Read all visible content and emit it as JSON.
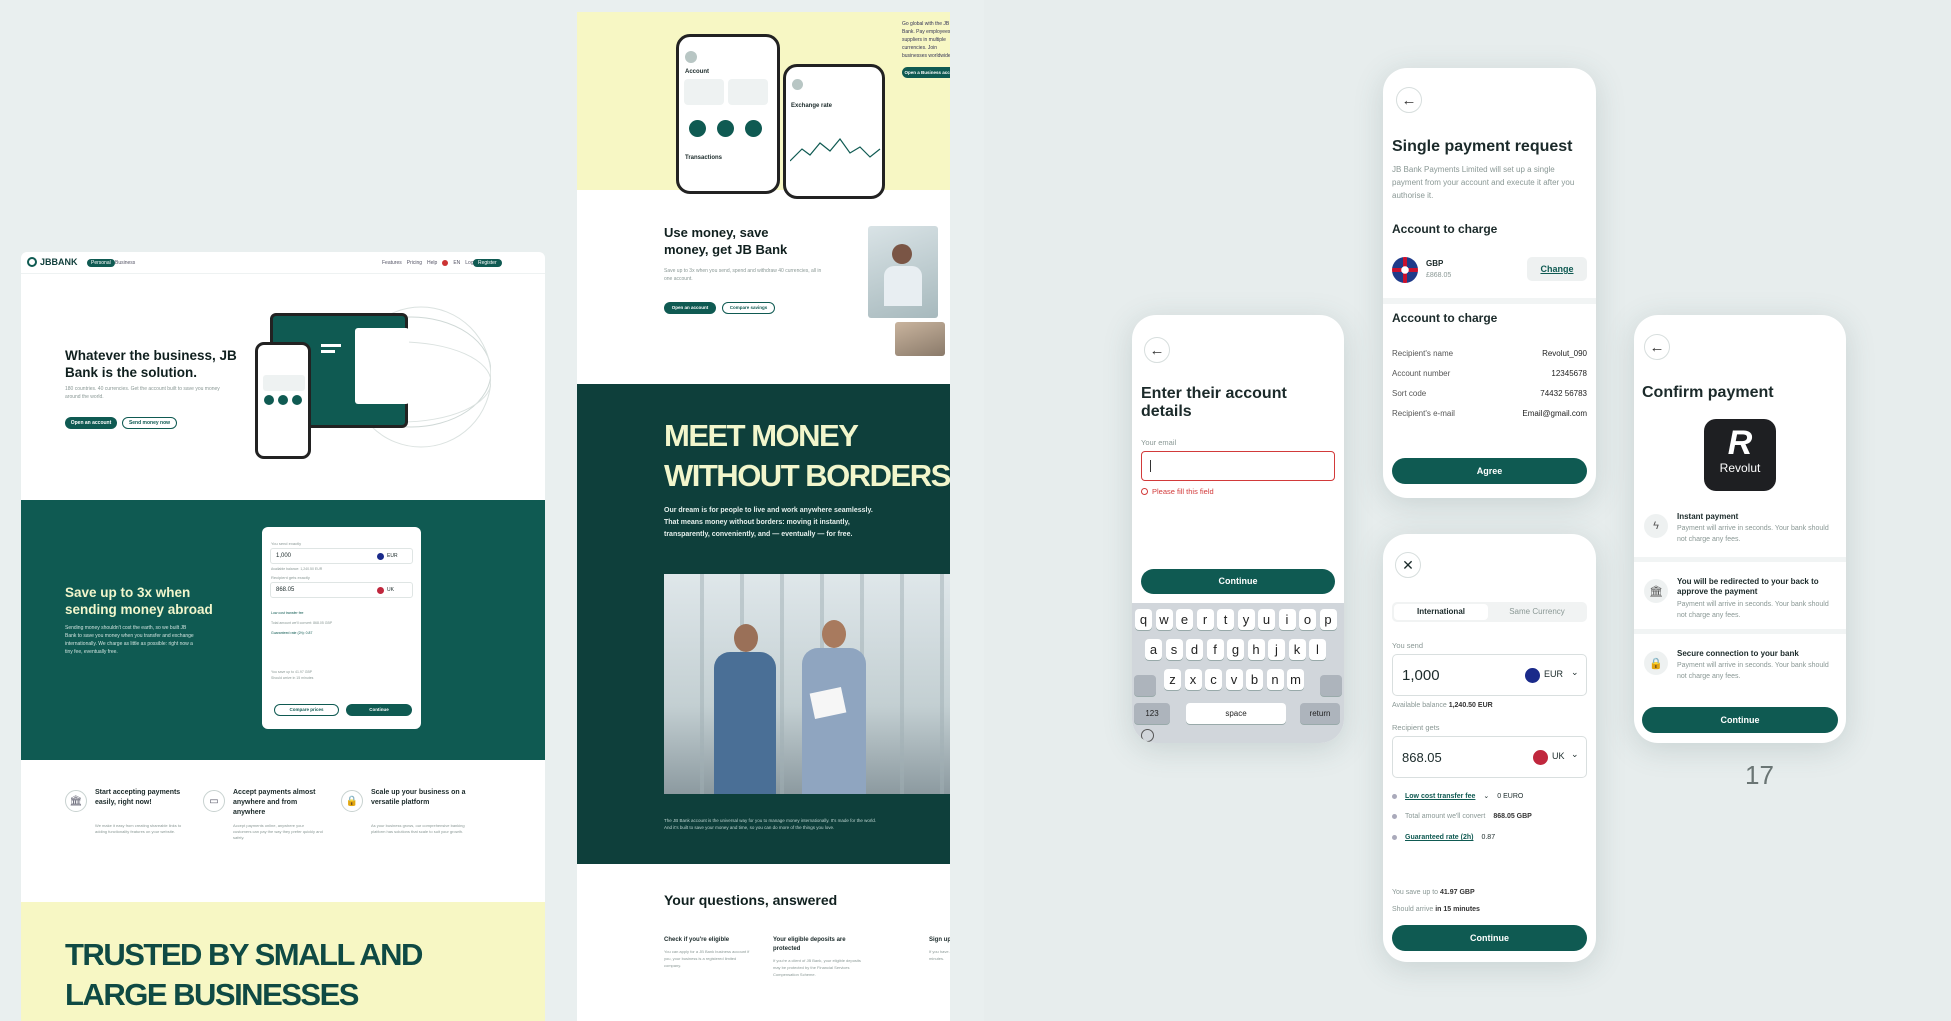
{
  "panel1": {
    "nav": {
      "logo": "JBBANK",
      "tabs": [
        "Personal",
        "Business"
      ],
      "links": [
        "Features",
        "Pricing",
        "Help",
        "EN",
        "Log in"
      ],
      "cta": "Register"
    },
    "hero": {
      "title": "Whatever the business, JB Bank is the solution.",
      "subtitle": "180 countries. 40 currencies. Get the account built to save you money around the world.",
      "btn1": "Open an account",
      "btn2": "Send money now"
    },
    "save": {
      "title": "Save up to 3x when sending money abroad",
      "body": "Sending money shouldn't cost the earth, so we built JB Bank to save you money when you transfer and exchange internationally. We charge as little as possible: right now a tiny fee, eventually free."
    },
    "converter": {
      "you_send_label": "You send exactly",
      "send_value": "1,000",
      "send_currency": "EUR",
      "balance": "Available balance: 1,240.50 EUR",
      "gets_label": "Recipient gets exactly",
      "gets_value": "868.05",
      "gets_currency": "UK",
      "fee": "Low cost transfer fee",
      "total": "Total amount we'll convert: 868.05 GBP",
      "rate": "Guaranteed rate (2h): 0.87",
      "save_note": "You save up to 41.97 GBP",
      "arrive": "Should arrive in 15 minutes",
      "btn_compare": "Compare prices",
      "btn_continue": "Continue"
    },
    "features": [
      {
        "icon": "bank-icon",
        "title": "Start accepting payments easily, right now!",
        "body": "We make it easy from creating shareable links to adding functionality features on your website."
      },
      {
        "icon": "card-icon",
        "title": "Accept payments almost anywhere and from anywhere",
        "body": "Accept payments online, anywhere your customers can pay the way they prefer quickly and safely."
      },
      {
        "icon": "lock-icon",
        "title": "Scale up your business on a versatile platform",
        "body": "As your business grows, our comprehensive banking platform has solutions that scale to suit your growth."
      }
    ],
    "trusted": "TRUSTED BY SMALL AND LARGE BUSINESSES"
  },
  "panel2": {
    "top_text": "Go global with the JB Bank. Pay employees, suppliers in multiple currencies. Join businesses worldwide.",
    "top_btn": "Open a Business account",
    "phone_account": "Account",
    "phone_transactions": "Transactions",
    "phone_rate": "Exchange rate",
    "use_money": {
      "title": "Use money, save money, get JB Bank",
      "body": "Save up to 3x when you send, spend and withdraw 40 currencies, all in one account.",
      "btn1": "Open an account",
      "btn2": "Compare savings"
    },
    "meet": {
      "title": "MEET MONEY WITHOUT BORDERS",
      "body": "Our dream is for people to live and work anywhere seamlessly. That means money without borders: moving it instantly, transparently, conveniently, and — eventually — for free.",
      "footer": "The JB Bank account is the universal way for you to manage money internationally. It's made for the world. And it's built to save your money and time, so you can do more of the things you love."
    },
    "faq": {
      "title": "Your questions, answered",
      "cols": [
        {
          "title": "Check if you're eligible",
          "body": "You can apply for a JB Bank business account if you, your business is a registered limited company."
        },
        {
          "title": "Your eligible deposits are protected",
          "body": "If you're a client of JB Bank, your eligible deposits may be protected by the Financial Services Compensation Scheme."
        },
        {
          "title": "Sign up",
          "body": "If you have a business, sign up in minutes."
        }
      ]
    }
  },
  "screen_email": {
    "title": "Enter their account details",
    "field_label": "Your email",
    "error": "Please fill this field",
    "btn": "Continue",
    "keys_row1": [
      "q",
      "w",
      "e",
      "r",
      "t",
      "y",
      "u",
      "i",
      "o",
      "p"
    ],
    "keys_row2": [
      "a",
      "s",
      "d",
      "f",
      "g",
      "h",
      "j",
      "k",
      "l"
    ],
    "keys_row3": [
      "z",
      "x",
      "c",
      "v",
      "b",
      "n",
      "m"
    ],
    "key_123": "123",
    "key_space": "space",
    "key_return": "return"
  },
  "screen_request": {
    "title": "Single payment request",
    "desc": "JB Bank Payments Limited will set up a single payment from your account and execute it after you authorise it.",
    "section1": "Account to charge",
    "currency": "GBP",
    "amount": "£868.05",
    "change": "Change",
    "section2": "Account to charge",
    "rows": [
      {
        "label": "Recipient's name",
        "value": "Revolut_090"
      },
      {
        "label": "Account number",
        "value": "12345678"
      },
      {
        "label": "Sort code",
        "value": "74432 56783"
      },
      {
        "label": "Recipient's e-mail",
        "value": "Email@gmail.com"
      }
    ],
    "btn": "Agree"
  },
  "screen_transfer": {
    "tab1": "International",
    "tab2": "Same Currency",
    "send_label": "You send",
    "send_value": "1,000",
    "send_currency": "EUR",
    "balance_prefix": "Available balance",
    "balance_value": "1,240.50 EUR",
    "gets_label": "Recipient gets",
    "gets_value": "868.05",
    "gets_currency": "UK",
    "fee_label": "Low cost transfer fee",
    "fee_value": "0 EURO",
    "total_label": "Total amount we'll convert",
    "total_value": "868.05 GBP",
    "rate_label": "Guaranteed rate (2h)",
    "rate_value": "0.87",
    "save_prefix": "You save up to",
    "save_value": "41.97 GBP",
    "arrive_prefix": "Should arrive",
    "arrive_value": "in 15 minutes",
    "btn": "Continue"
  },
  "screen_confirm": {
    "title": "Confirm payment",
    "logo_text": "Revolut",
    "items": [
      {
        "icon": "bolt-icon",
        "title": "Instant payment",
        "body": "Payment will arrive in seconds. Your bank should not charge any fees."
      },
      {
        "icon": "bank-icon",
        "title": "You will be redirected to your back to approve the payment",
        "body": "Payment will arrive in seconds. Your bank should not charge any fees."
      },
      {
        "icon": "lock-icon",
        "title": "Secure connection to your bank",
        "body": "Payment will arrive in seconds. Your bank should not charge any fees."
      }
    ],
    "btn": "Continue"
  },
  "page_number": "17",
  "colors": {
    "brand": "#0f5a52",
    "accent_yellow": "#f7f7c4",
    "background": "#e8eeee"
  }
}
